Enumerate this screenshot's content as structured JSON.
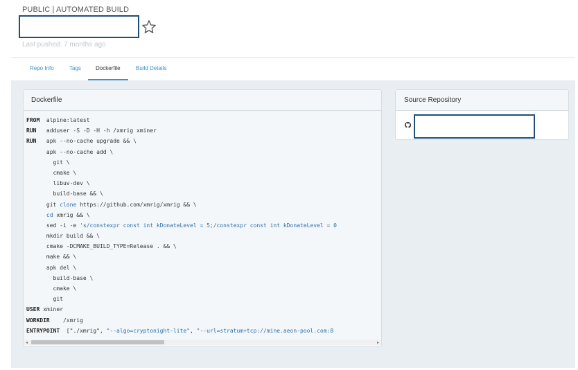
{
  "repo": {
    "visibility": "PUBLIC | AUTOMATED BUILD",
    "name": "",
    "last_pushed": "Last pushed: 7 months ago"
  },
  "tabs": [
    {
      "label": "Repo Info",
      "active": false
    },
    {
      "label": "Tags",
      "active": false
    },
    {
      "label": "Dockerfile",
      "active": true
    },
    {
      "label": "Build Details",
      "active": false
    }
  ],
  "dockerfile": {
    "title": "Dockerfile",
    "lines": [
      [
        {
          "t": "FROM",
          "c": "kw"
        },
        {
          "t": "  alpine:latest"
        }
      ],
      [
        {
          "t": "RUN",
          "c": "kw"
        },
        {
          "t": "   adduser -S -D -H -h /xmrig xminer"
        }
      ],
      [
        {
          "t": "RUN",
          "c": "kw"
        },
        {
          "t": "   apk --no-cache upgrade && \\"
        }
      ],
      [
        {
          "t": "      apk --no-cache add \\"
        }
      ],
      [
        {
          "t": "        git \\"
        }
      ],
      [
        {
          "t": "        cmake \\"
        }
      ],
      [
        {
          "t": "        libuv-dev \\"
        }
      ],
      [
        {
          "t": "        build-base && \\"
        }
      ],
      [
        {
          "t": "      git "
        },
        {
          "t": "clone",
          "c": "blue"
        },
        {
          "t": " https://github.com/xmrig/xmrig && \\"
        }
      ],
      [
        {
          "t": "      "
        },
        {
          "t": "cd",
          "c": "blue"
        },
        {
          "t": " xmrig && \\"
        }
      ],
      [
        {
          "t": "      sed -i -e "
        },
        {
          "t": "'s/constexpr const int kDonateLevel = 5;/constexpr const int kDonateLevel = 0",
          "c": "blue"
        }
      ],
      [
        {
          "t": "      mkdir build && \\"
        }
      ],
      [
        {
          "t": "      cmake -DCMAKE_BUILD_TYPE=Release . && \\"
        }
      ],
      [
        {
          "t": "      make && \\"
        }
      ],
      [
        {
          "t": "      apk del \\"
        }
      ],
      [
        {
          "t": "        build-base \\"
        }
      ],
      [
        {
          "t": "        cmake \\"
        }
      ],
      [
        {
          "t": "        git"
        }
      ],
      [
        {
          "t": "USER",
          "c": "kw"
        },
        {
          "t": " xminer"
        }
      ],
      [
        {
          "t": "WORKDIR",
          "c": "kw"
        },
        {
          "t": "    /xmrig"
        }
      ],
      [
        {
          "t": "ENTRYPOINT",
          "c": "kw"
        },
        {
          "t": "  [\"./xmrig\", "
        },
        {
          "t": "\"--algo=cryptonight-lite\"",
          "c": "blue"
        },
        {
          "t": ", "
        },
        {
          "t": "\"--url=stratum+tcp://mine.aeon-pool.com:8",
          "c": "blue"
        }
      ]
    ]
  },
  "scrollbar": {
    "left_arrow": "◂",
    "right_arrow": "▸",
    "position": 0.0
  },
  "source_repository": {
    "title": "Source Repository",
    "repo_name": "",
    "icon": "github-icon"
  }
}
